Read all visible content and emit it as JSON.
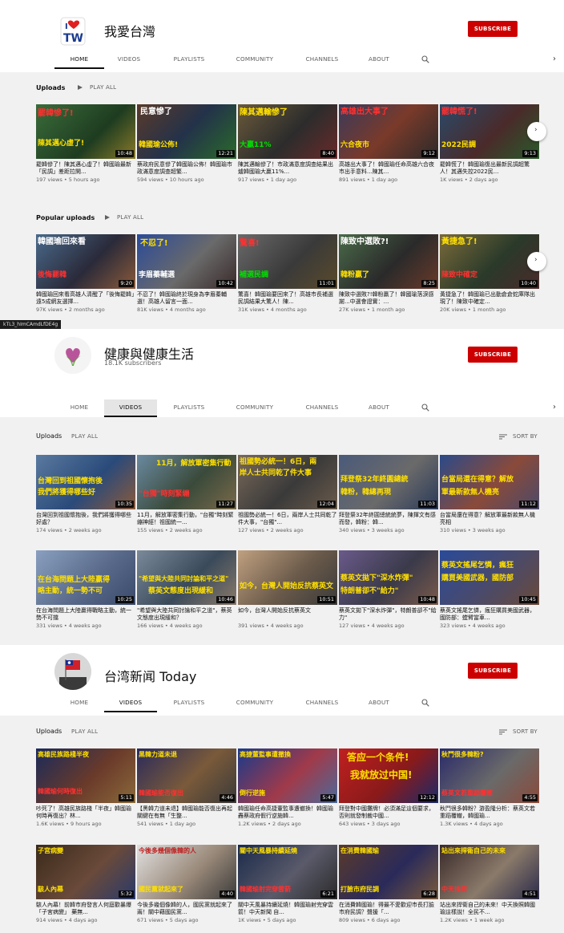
{
  "colors": {
    "subscribe": "#cc0000",
    "tab_active": "#0f0f0f",
    "meta": "#606060"
  },
  "link_tooltip": "kTL3_hImCAmdLfDE4g",
  "channel1": {
    "name": "我愛台灣",
    "avatar_icon": "i-love-tw-logo",
    "subscribe": "SUBSCRIBE",
    "tabs": [
      "HOME",
      "VIDEOS",
      "PLAYLISTS",
      "COMMUNITY",
      "CHANNELS",
      "ABOUT"
    ],
    "active_tab": "HOME",
    "uploads": {
      "title": "Uploads",
      "play_all": "PLAY ALL",
      "videos": [
        {
          "title": "罷韓慘了！陳其邁心虛了！韓國瑜最新「民調」差距拉開...",
          "meta": "197 views • 5 hours ago",
          "duration": "10:48"
        },
        {
          "title": "蔡政府民意慘了韓國瑜公佈！韓國瑜市政滿意度調查超繁...",
          "meta": "594 views • 10 hours ago",
          "duration": "12:21"
        },
        {
          "title": "陳其邁輸慘了！市政滿意度調查結果出爐韓國瑜大贏11%...",
          "meta": "917 views • 1 day ago",
          "duration": "8:40"
        },
        {
          "title": "高雄出大事了！韓國瑜任命高雄六合夜市出手意料...陳其...",
          "meta": "891 views • 1 day ago",
          "duration": "9:12"
        },
        {
          "title": "罷韓慌了！韓國瑜復出最新民調超驚人！其邁失控2022民...",
          "meta": "1K views • 2 days ago",
          "duration": "9:13"
        }
      ]
    },
    "popular": {
      "title": "Popular uploads",
      "play_all": "PLAY ALL",
      "videos": [
        {
          "title": "韓國瑜回來看高雄人清醒了「後悔罷韓」遠5成網友選擇...",
          "meta": "97K views • 2 months ago",
          "duration": "9:20"
        },
        {
          "title": "不忍了！韓國瑜終於現身為李眉蓁輔選！高雄人留言一面...",
          "meta": "81K views • 4 months ago",
          "duration": "10:42"
        },
        {
          "title": "驚喜！韓國瑜要回來了！高雄市長補選民調結果大驚人！陳...",
          "meta": "31K views • 4 months ago",
          "duration": "11:01"
        },
        {
          "title": "陳致中選敗?!韓粉贏了！韓國瑜落淚感謝...中選會證實：...",
          "meta": "27K views • 1 month ago",
          "duration": "8:25"
        },
        {
          "title": "黃捷急了！韓國瑜已出動倉倉蛇庫隊出現了！陳致中確定...",
          "meta": "20K views • 1 month ago",
          "duration": "10:40"
        }
      ]
    }
  },
  "channel2": {
    "name": "健康與健康生活",
    "subscribers": "18.1K subscribers",
    "avatar_icon": "heart-leaf-logo",
    "subscribe": "SUBSCRIBE",
    "tabs": [
      "HOME",
      "VIDEOS",
      "PLAYLISTS",
      "COMMUNITY",
      "CHANNELS",
      "ABOUT"
    ],
    "active_tab": "VIDEOS",
    "uploads_title": "Uploads",
    "play_all": "PLAY ALL",
    "sort_by": "SORT BY",
    "row1": [
      {
        "title": "台灣回到祖國懷抱後，我們將獲得哪些好處？",
        "meta": "174 views • 2 weeks ago",
        "duration": "10:35"
      },
      {
        "title": "11月，解放軍密集行動，\"台獨\"時刻緊繃神經！祖國統一...",
        "meta": "155 views • 2 weeks ago",
        "duration": "11:27"
      },
      {
        "title": "祖國勢必統一！6日，兩岸人士共同乾了件大事，\"台獨\"...",
        "meta": "127 views • 2 weeks ago",
        "duration": "12:04"
      },
      {
        "title": "拜登祭32年終圓總統統夢，陳揮文有感而發，韓粉：韓...",
        "meta": "340 views • 3 weeks ago",
        "duration": "11:03"
      },
      {
        "title": "台當局還在得意？解放軍最新款無人機亮相",
        "meta": "310 views • 3 weeks ago",
        "duration": "11:12"
      }
    ],
    "row2": [
      {
        "title": "在台海問題上大陸贏得戰略主動，統一勢不可擋",
        "meta": "331 views • 4 weeks ago",
        "duration": "10:25"
      },
      {
        "title": "\"希望與大陸共同討論和平之道\"，蔡英文態度出現緩和？",
        "meta": "166 views • 4 weeks ago",
        "duration": "10:46"
      },
      {
        "title": "如今，台灣人開始反抗蔡英文",
        "meta": "391 views • 4 weeks ago",
        "duration": "10:51"
      },
      {
        "title": "蔡英文拋下\"深水炸彈\"，特朗普卻不\"給力\"",
        "meta": "127 views • 4 weeks ago",
        "duration": "10:48"
      },
      {
        "title": "蔡英文搖尾乞憐，瘋狂購買美國武器，國防部：螳臂當車...",
        "meta": "323 views • 4 weeks ago",
        "duration": "10:45"
      }
    ]
  },
  "channel3": {
    "name": "台湾新闻 Today",
    "avatar_icon": "taiwan-flag-logo",
    "subscribe": "SUBSCRIBE",
    "tabs": [
      "HOME",
      "VIDEOS",
      "PLAYLISTS",
      "COMMUNITY",
      "CHANNELS",
      "ABOUT"
    ],
    "active_tab": "VIDEOS",
    "uploads_title": "Uploads",
    "play_all": "PLAY ALL",
    "sort_by": "SORT BY",
    "row1": [
      {
        "title": "吵死了！高雄民族路棧「半夜」韓國瑜何時再復出？林...",
        "meta": "1.6K views • 9 hours ago",
        "duration": "5:11"
      },
      {
        "title": "【黑韓力道未退】韓國瑜能否復出再起 關鍵在有無「生整...",
        "meta": "541 views • 1 day ago",
        "duration": "4:46"
      },
      {
        "title": "韓國瑜任命高捷董監事遭撤換！韓國瑜轟蔡政府假行逆施韓...",
        "meta": "1.2K views • 2 days ago",
        "duration": "5:47"
      },
      {
        "title": "拜登對中國攤牌！必須滿足這個要求，否則就發制裁中國...",
        "meta": "643 views • 3 days ago",
        "duration": "12:12"
      },
      {
        "title": "秋鬥很多韓粉？游盈隆分析：蔡英文若重蹈覆轍，韓國瑜...",
        "meta": "1.3K views • 4 days ago",
        "duration": "4:55"
      }
    ],
    "row2": [
      {
        "title": "駭人內幕！前韓市府發言人何庭歡暴爆「子宮病變」 藥無...",
        "meta": "914 views • 4 days ago",
        "duration": "5:32"
      },
      {
        "title": "今後多幾個像韓的人，國民黨就起來了兩！關中藉國民黨...",
        "meta": "671 views • 5 days ago",
        "duration": "4:40"
      },
      {
        "title": "關中天風暴持續延燒！韓國瑜射完穿雲箭！中天新聞 自...",
        "meta": "1K views • 5 days ago",
        "duration": "6:21"
      },
      {
        "title": "在消費韓國瑜！得最不愛歡迎市長打臉市府民調？聲援「...",
        "meta": "809 views • 6 days ago",
        "duration": "6:28"
      },
      {
        "title": "站出來捍衛自己的未來！中天換照韓國瑜這樣說！全民不...",
        "meta": "1.2K views • 1 week ago",
        "duration": "4:51"
      }
    ]
  }
}
